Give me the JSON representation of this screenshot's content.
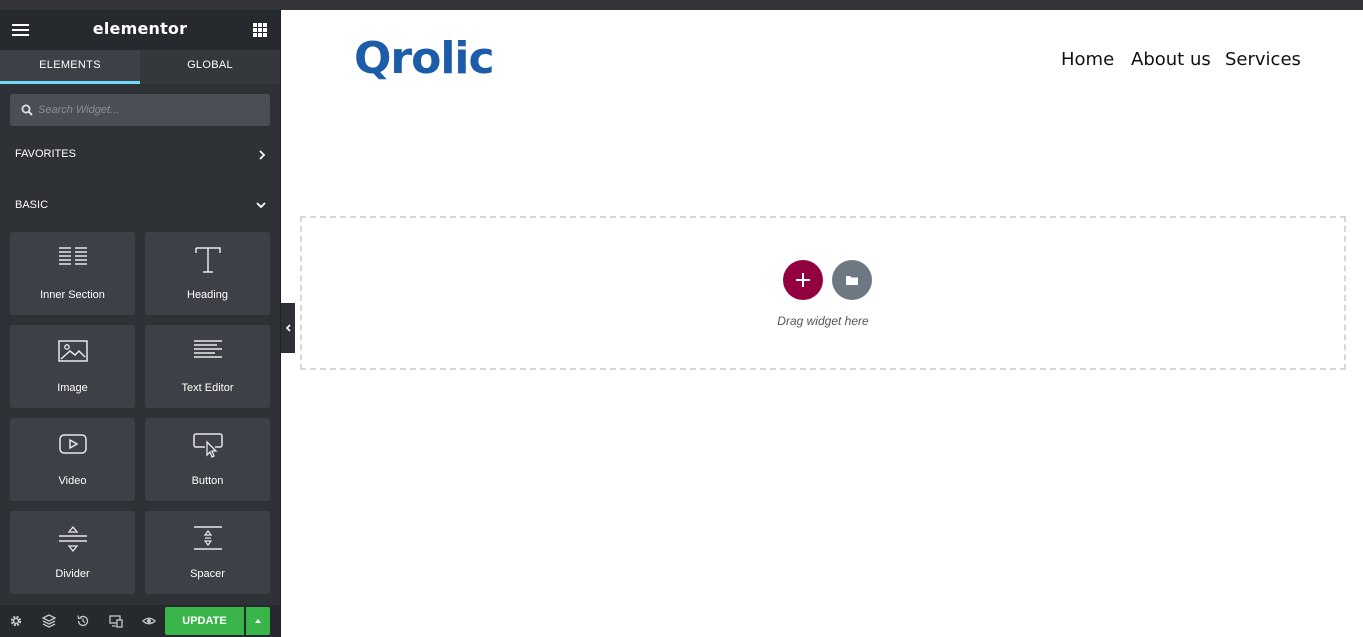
{
  "panel": {
    "logo": "elementor",
    "tabs": [
      {
        "label": "ELEMENTS"
      },
      {
        "label": "GLOBAL"
      }
    ],
    "search": {
      "placeholder": "Search Widget..."
    },
    "categories": [
      {
        "label": "FAVORITES"
      },
      {
        "label": "BASIC"
      }
    ],
    "widgets": [
      {
        "label": "Inner Section",
        "icon": "columns-icon"
      },
      {
        "label": "Heading",
        "icon": "heading-icon"
      },
      {
        "label": "Image",
        "icon": "image-icon"
      },
      {
        "label": "Text Editor",
        "icon": "text-editor-icon"
      },
      {
        "label": "Video",
        "icon": "video-icon"
      },
      {
        "label": "Button",
        "icon": "button-icon"
      },
      {
        "label": "Divider",
        "icon": "divider-icon"
      },
      {
        "label": "Spacer",
        "icon": "spacer-icon"
      }
    ],
    "footer": {
      "update_label": "UPDATE",
      "accent": "#39b54a"
    }
  },
  "site": {
    "brand": "Qrolic",
    "brand_color": "#1d5ca8",
    "nav": [
      {
        "label": "Home"
      },
      {
        "label": "About us"
      },
      {
        "label": "Services"
      }
    ],
    "dropzone_text": "Drag widget here",
    "add_color": "#93003f"
  }
}
